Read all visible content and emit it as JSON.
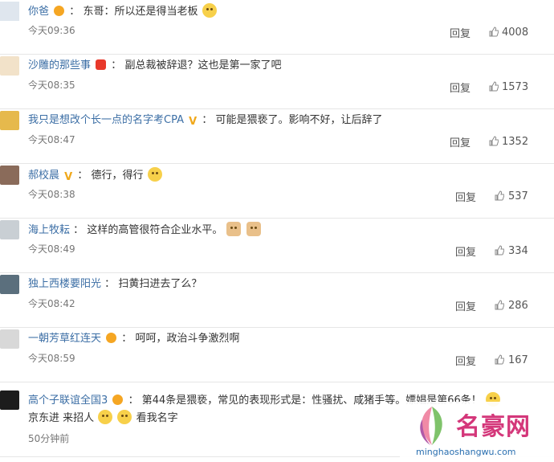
{
  "comments": [
    {
      "name": "你爸",
      "badge": "crown",
      "sep": "：",
      "content": "东哥：所以还是得当老板",
      "emoji": 1,
      "time": "今天09:36",
      "reply": "回复",
      "likes": "4008"
    },
    {
      "name": "沙雕的那些事",
      "badge": "v-red",
      "sep": "：",
      "content": "副总裁被辞退？这也是第一家了吧",
      "emoji": 0,
      "time": "今天08:35",
      "reply": "回复",
      "likes": "1573"
    },
    {
      "name": "我只是想改个长一点的名字考CPA",
      "badge": "v-gold",
      "sep": "：",
      "content": "可能是猥亵了。影响不好，让后辞了",
      "emoji": 0,
      "time": "今天08:47",
      "reply": "回复",
      "likes": "1352"
    },
    {
      "name": "郝校晨",
      "badge": "v-gold",
      "sep": "：",
      "content": "德行，得行",
      "emoji": 1,
      "time": "今天08:38",
      "reply": "回复",
      "likes": "537"
    },
    {
      "name": "海上牧耘",
      "badge": "",
      "sep": "：",
      "content": "这样的高管很符合企业水平。",
      "emoji": 2,
      "time": "今天08:49",
      "reply": "回复",
      "likes": "334"
    },
    {
      "name": "独上西楼要阳光",
      "badge": "",
      "sep": "：",
      "content": "扫黄扫进去了么？",
      "emoji": 0,
      "time": "今天08:42",
      "reply": "回复",
      "likes": "286"
    },
    {
      "name": "一朝芳草红连天",
      "badge": "crown",
      "sep": "：",
      "content": "呵呵，政治斗争激烈啊",
      "emoji": 0,
      "time": "今天08:59",
      "reply": "回复",
      "likes": "167"
    },
    {
      "name": "高个子联谊全国3",
      "badge": "crown",
      "sep": "：",
      "content": "第44条是猥亵，常见的表现形式是：性骚扰、咸猪手等。嫖娼是第66条！",
      "line2a": "京东进",
      "line2b": "来招人",
      "line2c": "看我名字",
      "time": "50分钟前",
      "reply": "",
      "likes": ""
    }
  ],
  "watermark": {
    "title": "名豪网",
    "url": "minghaoshangwu.com"
  },
  "colors": {
    "name": "#3b6ea5",
    "text": "#333333",
    "meta": "#777777",
    "divider": "#e6e6e6",
    "brand": "#d4377a"
  }
}
